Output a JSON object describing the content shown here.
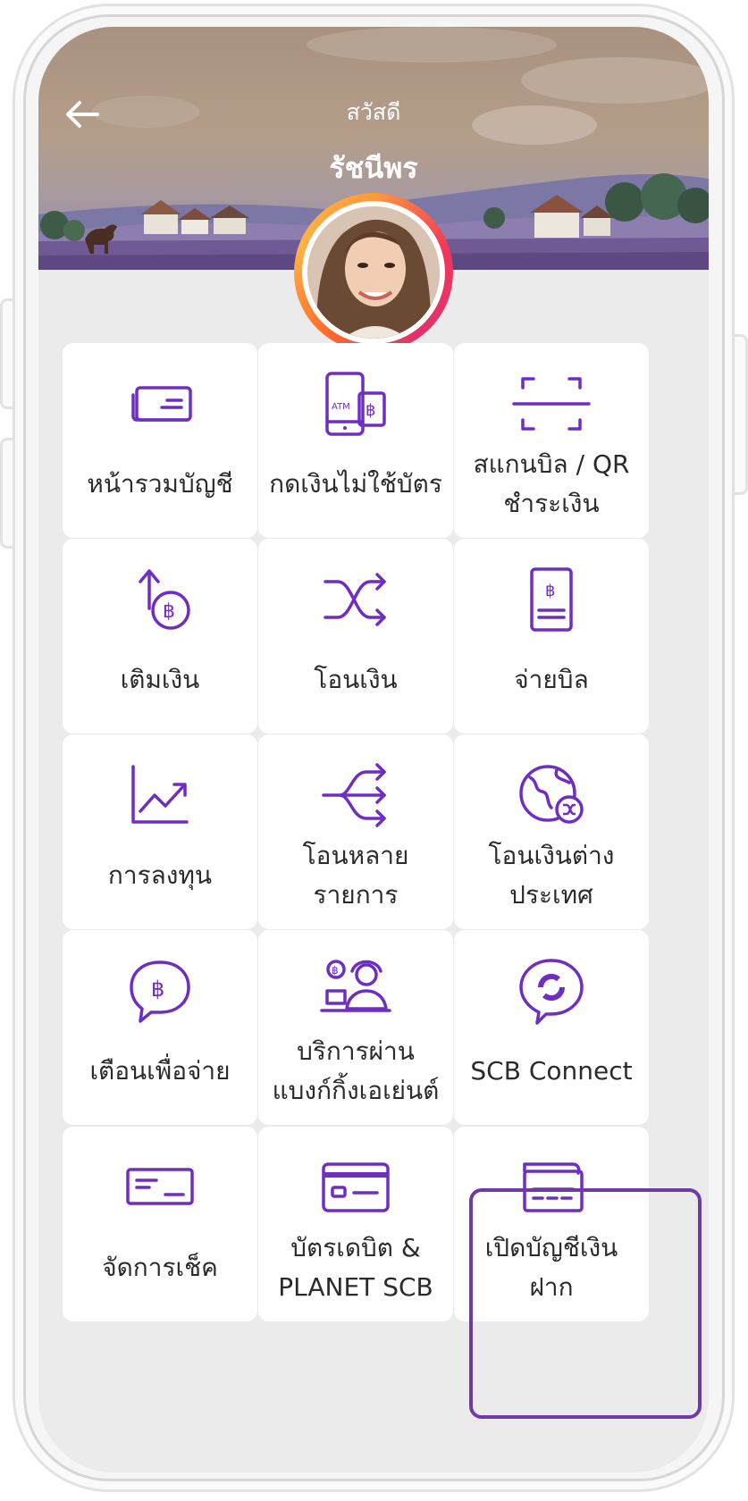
{
  "header": {
    "greeting": "สวัสดี",
    "user_name": "รัชนีพร"
  },
  "colors": {
    "accent": "#6e2ec2",
    "highlight_border": "#6e3aa8",
    "tile_bg": "#ffffff",
    "screen_bg": "#ebebeb"
  },
  "menu": [
    {
      "label_lines": [
        "หน้ารวมบัญชี"
      ],
      "icon": "cards-icon"
    },
    {
      "label_lines": [
        "กดเงินไม่ใช้บัตร"
      ],
      "icon": "cardless-atm-icon",
      "icon_text": "ATM"
    },
    {
      "label_lines": [
        "สแกนบิล / QR",
        "ชำระเงิน"
      ],
      "icon": "scan-icon"
    },
    {
      "label_lines": [
        "เติมเงิน"
      ],
      "icon": "topup-icon"
    },
    {
      "label_lines": [
        "โอนเงิน"
      ],
      "icon": "transfer-icon"
    },
    {
      "label_lines": [
        "จ่ายบิล"
      ],
      "icon": "bill-icon"
    },
    {
      "label_lines": [
        "การลงทุน"
      ],
      "icon": "invest-chart-icon"
    },
    {
      "label_lines": [
        "โอนหลาย",
        "รายการ"
      ],
      "icon": "multi-transfer-icon"
    },
    {
      "label_lines": [
        "โอนเงินต่าง",
        "ประเทศ"
      ],
      "icon": "globe-transfer-icon"
    },
    {
      "label_lines": [
        "เตือนเพื่อจ่าย"
      ],
      "icon": "request-pay-icon"
    },
    {
      "label_lines": [
        "บริการผ่าน",
        "แบงก์กิ้งเอเย่นต์"
      ],
      "icon": "banking-agent-icon"
    },
    {
      "label_lines": [
        "SCB Connect"
      ],
      "icon": "scb-connect-icon"
    },
    {
      "label_lines": [
        "จัดการเช็ค"
      ],
      "icon": "cheque-icon"
    },
    {
      "label_lines": [
        "บัตรเดบิต &",
        "PLANET SCB"
      ],
      "icon": "debit-card-icon"
    },
    {
      "label_lines": [
        "เปิดบัญชีเงิน",
        "ฝาก"
      ],
      "icon": "open-account-icon"
    }
  ]
}
